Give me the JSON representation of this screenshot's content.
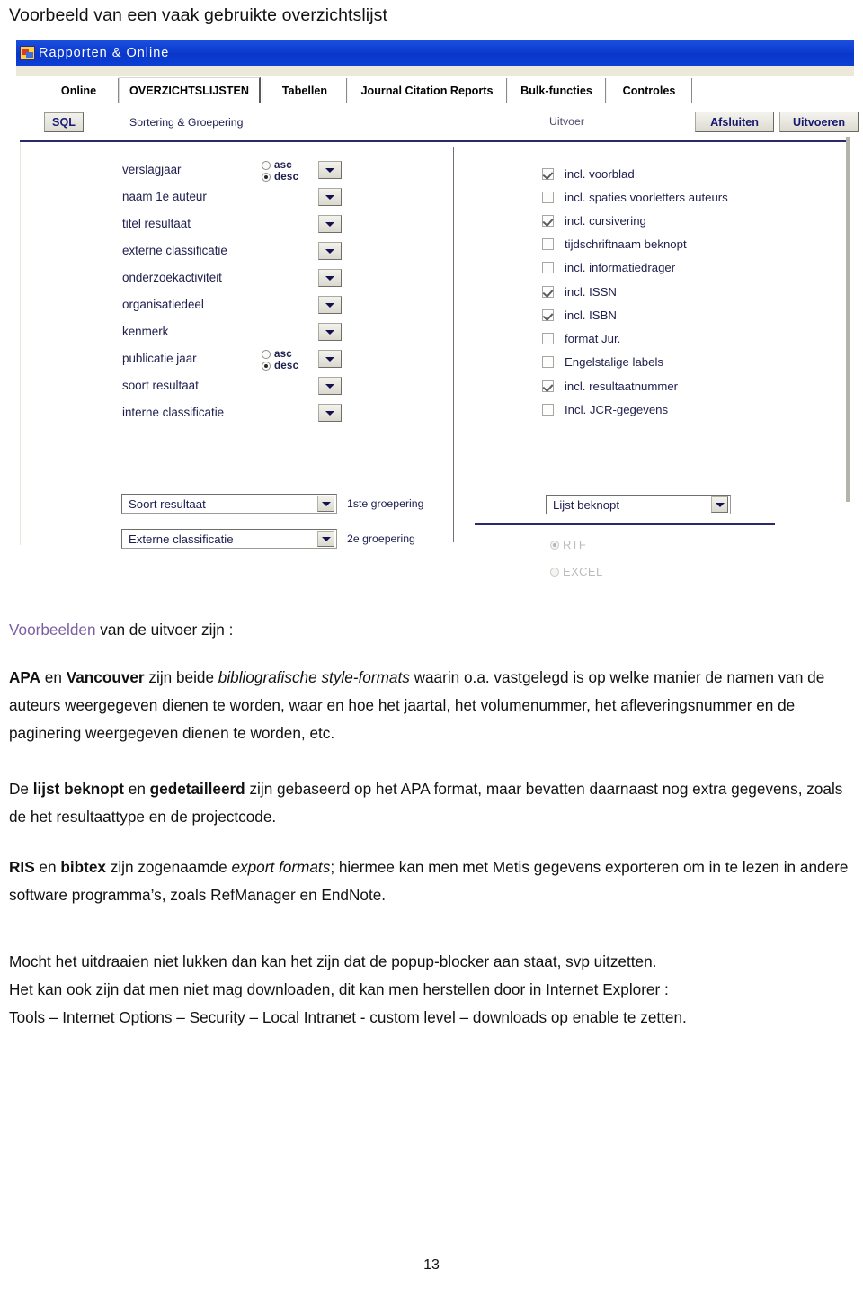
{
  "document": {
    "heading": "Voorbeeld van een vaak gebruikte overzichtslijst",
    "page_number": "13"
  },
  "app": {
    "title": "Rapporten & Online",
    "icon": "app-window-icon",
    "tabs": [
      {
        "label": "Online",
        "active": false
      },
      {
        "label": "OVERZICHTSLIJSTEN",
        "active": true
      },
      {
        "label": "Tabellen",
        "active": false
      },
      {
        "label": "Journal Citation Reports",
        "active": false
      },
      {
        "label": "Bulk-functies",
        "active": false
      },
      {
        "label": "Controles",
        "active": false
      }
    ],
    "toolbar": {
      "sql_button": "SQL",
      "sorting_label": "Sortering & Groepering",
      "output_label": "Uitvoer",
      "close_button": "Afsluiten",
      "run_button": "Uitvoeren"
    },
    "sort_fields": [
      {
        "label": "verslagjaar",
        "has_order": true,
        "asc_label": "asc",
        "desc_label": "desc",
        "selected": "desc"
      },
      {
        "label": "naam 1e auteur",
        "has_order": false
      },
      {
        "label": "titel resultaat",
        "has_order": false
      },
      {
        "label": "externe classificatie",
        "has_order": false
      },
      {
        "label": "onderzoekactiviteit",
        "has_order": false
      },
      {
        "label": "organisatiedeel",
        "has_order": false
      },
      {
        "label": "kenmerk",
        "has_order": false
      },
      {
        "label": "publicatie jaar",
        "has_order": true,
        "asc_label": "asc",
        "desc_label": "desc",
        "selected": "desc"
      },
      {
        "label": "soort resultaat",
        "has_order": false
      },
      {
        "label": "interne classificatie",
        "has_order": false
      }
    ],
    "options": [
      {
        "label": "incl. voorblad",
        "checked": true
      },
      {
        "label": "incl. spaties voorletters auteurs",
        "checked": false
      },
      {
        "label": "incl. cursivering",
        "checked": true
      },
      {
        "label": "tijdschriftnaam beknopt",
        "checked": false
      },
      {
        "label": "incl. informatiedrager",
        "checked": false
      },
      {
        "label": "incl. ISSN",
        "checked": true
      },
      {
        "label": "incl. ISBN",
        "checked": true
      },
      {
        "label": "format Jur.",
        "checked": false
      },
      {
        "label": "Engelstalige labels",
        "checked": false
      },
      {
        "label": "incl. resultaatnummer",
        "checked": true
      },
      {
        "label": "Incl. JCR-gegevens",
        "checked": false
      }
    ],
    "grouping": [
      {
        "value": "Soort resultaat",
        "caption": "1ste groepering"
      },
      {
        "value": "Externe classificatie",
        "caption": "2e groepering"
      }
    ],
    "output_format": {
      "list_select_value": "Lijst beknopt",
      "radios": [
        {
          "label": "RTF",
          "selected": true,
          "disabled": true
        },
        {
          "label": "EXCEL",
          "selected": false,
          "disabled": true
        }
      ]
    }
  },
  "text": {
    "examples_link": "Voorbeelden",
    "examples_rest": " van de uitvoer zijn :",
    "p2": {
      "b1": "APA",
      "t1": " en ",
      "b2": "Vancouver",
      "t2": " zijn beide ",
      "i1": "bibliografische style-formats",
      "t3": " waarin o.a. vastgelegd is  op welke manier de namen van de auteurs weergegeven dienen te worden, waar en hoe het jaartal, het volumenummer, het afleveringsnummer en de paginering weergegeven dienen te worden, etc."
    },
    "p3": {
      "t0": "De ",
      "b1": "lijst beknopt",
      "t1": " en ",
      "b2": "gedetailleerd",
      "t2": " zijn gebaseerd op het APA format, maar bevatten daarnaast nog extra gegevens, zoals de het resultaattype en de projectcode."
    },
    "p4": {
      "b1": "RIS",
      "t1": " en ",
      "b2": "bibtex",
      "t2": " zijn zogenaamde ",
      "i1": "export formats",
      "t3": "; hiermee kan men met Metis gegevens exporteren om in te lezen in andere software programma’s, zoals RefManager en EndNote."
    },
    "p5_line1": "Mocht het uitdraaien niet lukken dan kan het zijn dat de popup-blocker aan staat, svp uitzetten.",
    "p5_line2": "Het kan ook zijn dat men niet mag downloaden, dit kan men herstellen door  in Internet Explorer :",
    "p5_line3": "Tools – Internet Options – Security – Local Intranet - custom level – downloads op enable te zetten."
  },
  "colors": {
    "titlebar": "#0b3fd6",
    "label_text": "#20204f",
    "accent_rule": "#2a2a6b",
    "link_violet": "#7c5fa3",
    "disabled_text": "#bcbcbc"
  }
}
